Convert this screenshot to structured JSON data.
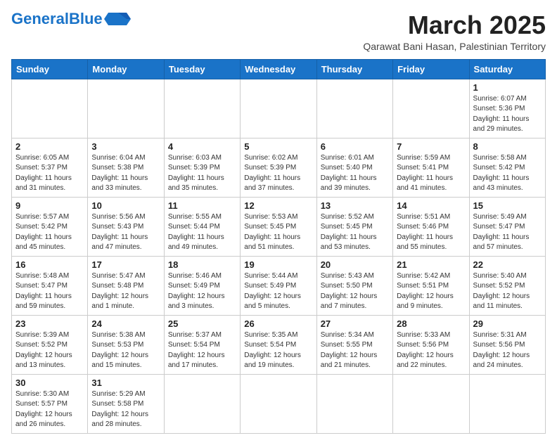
{
  "header": {
    "logo_general": "General",
    "logo_blue": "Blue",
    "month": "March 2025",
    "location": "Qarawat Bani Hasan, Palestinian Territory"
  },
  "weekdays": [
    "Sunday",
    "Monday",
    "Tuesday",
    "Wednesday",
    "Thursday",
    "Friday",
    "Saturday"
  ],
  "weeks": [
    [
      {
        "day": "",
        "info": ""
      },
      {
        "day": "",
        "info": ""
      },
      {
        "day": "",
        "info": ""
      },
      {
        "day": "",
        "info": ""
      },
      {
        "day": "",
        "info": ""
      },
      {
        "day": "",
        "info": ""
      },
      {
        "day": "1",
        "info": "Sunrise: 6:07 AM\nSunset: 5:36 PM\nDaylight: 11 hours\nand 29 minutes."
      }
    ],
    [
      {
        "day": "2",
        "info": "Sunrise: 6:05 AM\nSunset: 5:37 PM\nDaylight: 11 hours\nand 31 minutes."
      },
      {
        "day": "3",
        "info": "Sunrise: 6:04 AM\nSunset: 5:38 PM\nDaylight: 11 hours\nand 33 minutes."
      },
      {
        "day": "4",
        "info": "Sunrise: 6:03 AM\nSunset: 5:39 PM\nDaylight: 11 hours\nand 35 minutes."
      },
      {
        "day": "5",
        "info": "Sunrise: 6:02 AM\nSunset: 5:39 PM\nDaylight: 11 hours\nand 37 minutes."
      },
      {
        "day": "6",
        "info": "Sunrise: 6:01 AM\nSunset: 5:40 PM\nDaylight: 11 hours\nand 39 minutes."
      },
      {
        "day": "7",
        "info": "Sunrise: 5:59 AM\nSunset: 5:41 PM\nDaylight: 11 hours\nand 41 minutes."
      },
      {
        "day": "8",
        "info": "Sunrise: 5:58 AM\nSunset: 5:42 PM\nDaylight: 11 hours\nand 43 minutes."
      }
    ],
    [
      {
        "day": "9",
        "info": "Sunrise: 5:57 AM\nSunset: 5:42 PM\nDaylight: 11 hours\nand 45 minutes."
      },
      {
        "day": "10",
        "info": "Sunrise: 5:56 AM\nSunset: 5:43 PM\nDaylight: 11 hours\nand 47 minutes."
      },
      {
        "day": "11",
        "info": "Sunrise: 5:55 AM\nSunset: 5:44 PM\nDaylight: 11 hours\nand 49 minutes."
      },
      {
        "day": "12",
        "info": "Sunrise: 5:53 AM\nSunset: 5:45 PM\nDaylight: 11 hours\nand 51 minutes."
      },
      {
        "day": "13",
        "info": "Sunrise: 5:52 AM\nSunset: 5:45 PM\nDaylight: 11 hours\nand 53 minutes."
      },
      {
        "day": "14",
        "info": "Sunrise: 5:51 AM\nSunset: 5:46 PM\nDaylight: 11 hours\nand 55 minutes."
      },
      {
        "day": "15",
        "info": "Sunrise: 5:49 AM\nSunset: 5:47 PM\nDaylight: 11 hours\nand 57 minutes."
      }
    ],
    [
      {
        "day": "16",
        "info": "Sunrise: 5:48 AM\nSunset: 5:47 PM\nDaylight: 11 hours\nand 59 minutes."
      },
      {
        "day": "17",
        "info": "Sunrise: 5:47 AM\nSunset: 5:48 PM\nDaylight: 12 hours\nand 1 minute."
      },
      {
        "day": "18",
        "info": "Sunrise: 5:46 AM\nSunset: 5:49 PM\nDaylight: 12 hours\nand 3 minutes."
      },
      {
        "day": "19",
        "info": "Sunrise: 5:44 AM\nSunset: 5:49 PM\nDaylight: 12 hours\nand 5 minutes."
      },
      {
        "day": "20",
        "info": "Sunrise: 5:43 AM\nSunset: 5:50 PM\nDaylight: 12 hours\nand 7 minutes."
      },
      {
        "day": "21",
        "info": "Sunrise: 5:42 AM\nSunset: 5:51 PM\nDaylight: 12 hours\nand 9 minutes."
      },
      {
        "day": "22",
        "info": "Sunrise: 5:40 AM\nSunset: 5:52 PM\nDaylight: 12 hours\nand 11 minutes."
      }
    ],
    [
      {
        "day": "23",
        "info": "Sunrise: 5:39 AM\nSunset: 5:52 PM\nDaylight: 12 hours\nand 13 minutes."
      },
      {
        "day": "24",
        "info": "Sunrise: 5:38 AM\nSunset: 5:53 PM\nDaylight: 12 hours\nand 15 minutes."
      },
      {
        "day": "25",
        "info": "Sunrise: 5:37 AM\nSunset: 5:54 PM\nDaylight: 12 hours\nand 17 minutes."
      },
      {
        "day": "26",
        "info": "Sunrise: 5:35 AM\nSunset: 5:54 PM\nDaylight: 12 hours\nand 19 minutes."
      },
      {
        "day": "27",
        "info": "Sunrise: 5:34 AM\nSunset: 5:55 PM\nDaylight: 12 hours\nand 21 minutes."
      },
      {
        "day": "28",
        "info": "Sunrise: 5:33 AM\nSunset: 5:56 PM\nDaylight: 12 hours\nand 22 minutes."
      },
      {
        "day": "29",
        "info": "Sunrise: 5:31 AM\nSunset: 5:56 PM\nDaylight: 12 hours\nand 24 minutes."
      }
    ],
    [
      {
        "day": "30",
        "info": "Sunrise: 5:30 AM\nSunset: 5:57 PM\nDaylight: 12 hours\nand 26 minutes."
      },
      {
        "day": "31",
        "info": "Sunrise: 5:29 AM\nSunset: 5:58 PM\nDaylight: 12 hours\nand 28 minutes."
      },
      {
        "day": "",
        "info": ""
      },
      {
        "day": "",
        "info": ""
      },
      {
        "day": "",
        "info": ""
      },
      {
        "day": "",
        "info": ""
      },
      {
        "day": "",
        "info": ""
      }
    ]
  ]
}
